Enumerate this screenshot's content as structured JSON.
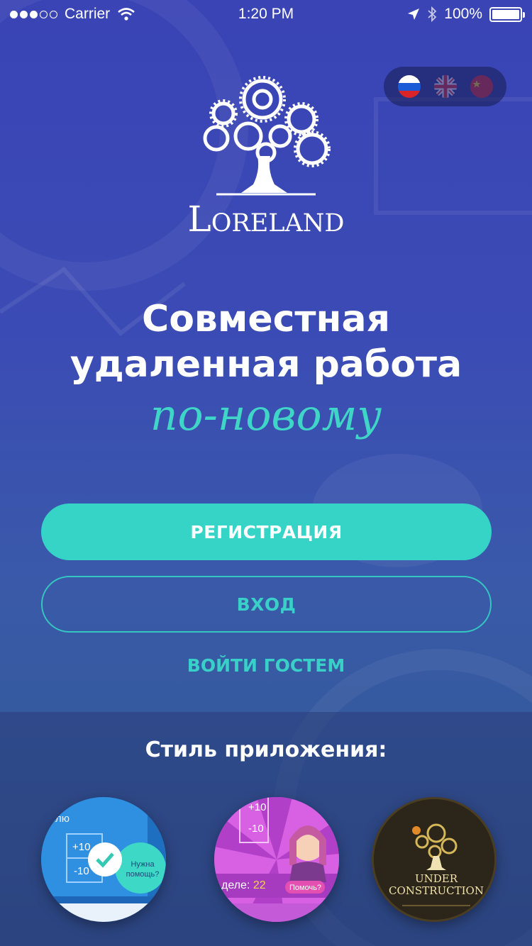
{
  "status_bar": {
    "carrier": "Carrier",
    "time": "1:20 PM",
    "battery": "100%"
  },
  "languages": [
    {
      "name": "russian-flag-icon",
      "active": true
    },
    {
      "name": "uk-flag-icon",
      "active": false
    },
    {
      "name": "china-flag-icon",
      "active": false
    }
  ],
  "logo": {
    "text": "Loreland"
  },
  "headline": {
    "line1": "Совместная",
    "line2": "удаленная работа",
    "accent": "по-новому"
  },
  "actions": {
    "register": "РЕГИСТРАЦИЯ",
    "login": "ВХОД",
    "guest": "ВОЙТИ ГОСТЕМ"
  },
  "styles": {
    "title": "Стиль приложения:",
    "theme1": {
      "label": "олю",
      "plus": "+10",
      "minus": "-10",
      "help": "Нужна помощь?"
    },
    "theme2": {
      "plus": "+10",
      "minus": "-10",
      "week_label": "деле:",
      "week_value": "22",
      "help": "Помочь?"
    },
    "theme3": {
      "line1": "UNDER",
      "line2": "CONSTRUCTION"
    }
  },
  "colors": {
    "accent": "#35d4c7",
    "background_top": "#3a44b5",
    "background_bottom": "#2f4f8b"
  }
}
